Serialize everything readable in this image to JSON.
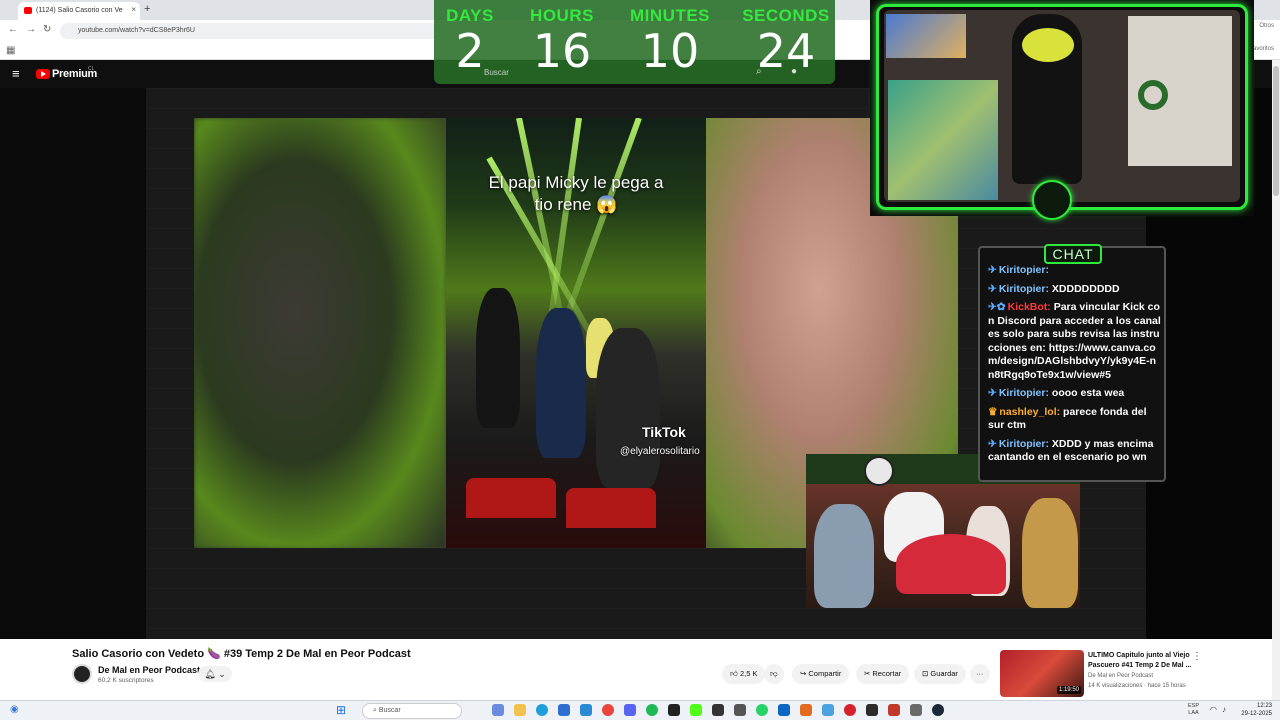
{
  "browser": {
    "tab_title": "(1124) Salio Casorio con Ve",
    "url": "youtube.com/watch?v=dCS8eP3hr6U",
    "favorites_label": "Favoritos",
    "extensions_label": "Otros"
  },
  "youtube": {
    "brand": "Premium",
    "brand_region": "CL",
    "search_placeholder": "Buscar"
  },
  "countdown": {
    "units": [
      {
        "label": "DAYS",
        "value": "2"
      },
      {
        "label": "HOURS",
        "value": "16"
      },
      {
        "label": "MINUTES",
        "value": "10"
      },
      {
        "label": "SECONDS",
        "value": "24"
      }
    ],
    "accent": "#34e83c"
  },
  "clip": {
    "caption_line1": "El papi Micky le pega a",
    "caption_line2": "tio rene 😱",
    "tiktok_label": "TikTok",
    "tiktok_user": "@elyalerosolitario"
  },
  "chat": {
    "title": "CHAT",
    "messages": [
      {
        "user": "Kiritopier:",
        "text": ""
      },
      {
        "user": "Kiritopier:",
        "text": "XDDDDDDDD"
      },
      {
        "user": "KickBot:",
        "text": "Para vincular Kick con Discord para acceder a los canales solo para subs revisa las instrucciones en: https://www.canva.com/design/DAGlshbdvyY/yk9y4E-nn8tRgq9oTe9x1w/view#5"
      },
      {
        "user": "Kiritopier:",
        "text": "oooo esta wea"
      },
      {
        "user": "nashley_lol:",
        "text": "parece fonda del sur ctm"
      },
      {
        "user": "Kiritopier:",
        "text": "XDDD y mas encima cantando en el escenario po wn"
      }
    ]
  },
  "video": {
    "title": "Salio Casorio con Vedeto 🍆 #39 Temp 2 De Mal en Peor Podcast",
    "channel": "De Mal en Peor Podcast",
    "subscribers": "60,2 K suscriptores",
    "likes": "2,5 K",
    "share_label": "Compartir",
    "clip_label": "Recortar",
    "save_label": "Guardar",
    "more_label": "···"
  },
  "recommended": {
    "title": "ULTIMO Capitulo junto al Viejo Pascuero #41 Temp 2 De Mal ...",
    "channel": "De Mal en Peor Podcast",
    "meta": "14 K visualizaciones · hace 15 horas",
    "duration": "1:19:50"
  },
  "taskbar": {
    "search_placeholder": "Buscar",
    "lang_line1": "ESP",
    "lang_line2": "LAA",
    "time": "12:23",
    "date": "29-12-2025"
  }
}
